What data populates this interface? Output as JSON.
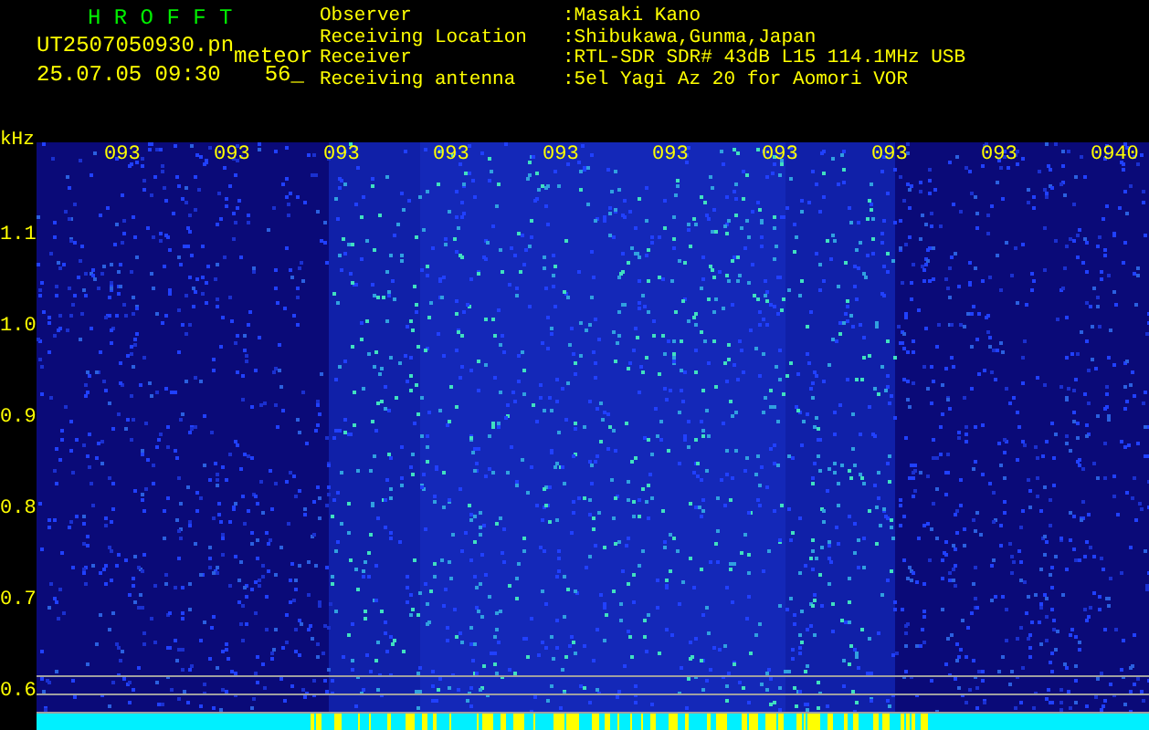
{
  "app": {
    "title": "H R O F F T",
    "filename": "UT2507050930.pn",
    "event_type": "meteor",
    "timestamp": "25.07.05 09:30",
    "count": "56_"
  },
  "station_info": [
    {
      "label": "Observer",
      "value": ":Masaki Kano"
    },
    {
      "label": "Receiving Location",
      "value": ":Shibukawa,Gunma,Japan"
    },
    {
      "label": "Receiver",
      "value": ":RTL-SDR SDR# 43dB L15 114.1MHz USB"
    },
    {
      "label": "Receiving antenna",
      "value": ":5el Yagi Az 20 for Aomori VOR"
    }
  ],
  "spectrogram": {
    "unit": "kHz",
    "time_labels": [
      "093",
      "093",
      "093",
      "093",
      "093",
      "093",
      "093",
      "093",
      "093",
      "0940"
    ],
    "freq_labels": [
      "1.1",
      "1.0",
      "0.9",
      "0.8",
      "0.7",
      "0.6"
    ]
  }
}
